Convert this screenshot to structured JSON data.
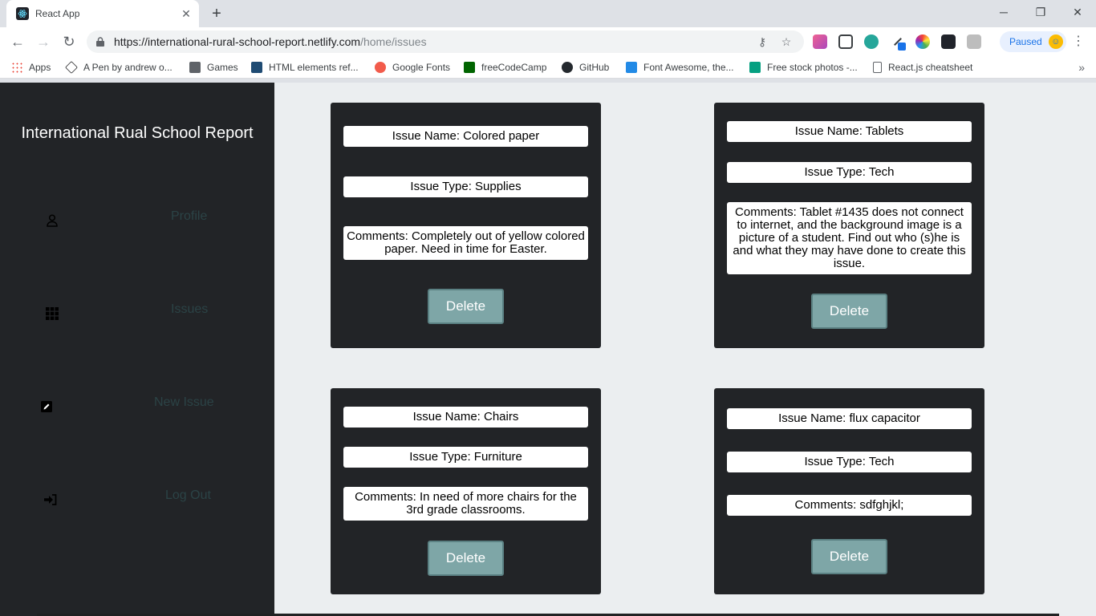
{
  "browser": {
    "tab_title": "React App",
    "url_host": "https://international-rural-school-report.netlify.com",
    "url_path": "/home/issues",
    "paused_label": "Paused",
    "bookmarks": [
      "Apps",
      "A Pen by andrew o...",
      "Games",
      "HTML elements ref...",
      "Google Fonts",
      "freeCodeCamp",
      "GitHub",
      "Font Awesome, the...",
      "Free stock photos -...",
      "React.js cheatsheet"
    ]
  },
  "app": {
    "title": "International Rual School Report",
    "nav": [
      {
        "label": "Profile",
        "icon": "user-icon"
      },
      {
        "label": "Issues",
        "icon": "grid-icon"
      },
      {
        "label": "New Issue",
        "icon": "edit-icon"
      },
      {
        "label": "Log Out",
        "icon": "sign-in-icon"
      }
    ],
    "delete_label": "Delete",
    "issues": [
      {
        "name": "Issue Name: Colored paper",
        "type": "Issue Type: Supplies",
        "comments": "Comments: Completely out of yellow colored paper. Need in time for Easter."
      },
      {
        "name": "Issue Name: Tablets",
        "type": "Issue Type: Tech",
        "comments": "Comments: Tablet #1435 does not connect to internet, and the background image is a picture of a student. Find out who (s)he is and what they may have done to create this issue."
      },
      {
        "name": "Issue Name: Chairs",
        "type": "Issue Type: Furniture",
        "comments": "Comments: In need of more chairs for the 3rd grade classrooms."
      },
      {
        "name": "Issue Name: flux capacitor",
        "type": "Issue Type: Tech",
        "comments": "Comments: sdfghjkl;"
      }
    ]
  },
  "colors": {
    "sidebar_bg": "#222427",
    "content_bg": "#ebeef0",
    "button_bg": "#7ea6a7",
    "nav_label": "#2b4346"
  }
}
